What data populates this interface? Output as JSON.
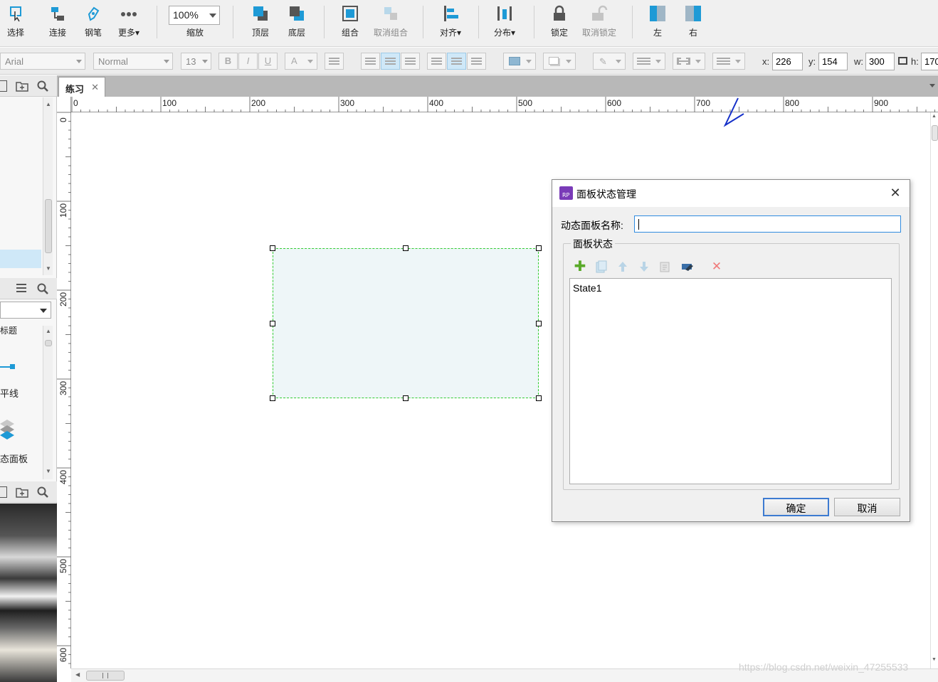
{
  "toolbar": {
    "select": "选择",
    "connect": "连接",
    "pen": "钢笔",
    "more": "更多▾",
    "zoom_value": "100%",
    "zoom": "缩放",
    "top_layer": "顶层",
    "bottom_layer": "底层",
    "group": "组合",
    "ungroup": "取消组合",
    "align": "对齐▾",
    "distribute": "分布▾",
    "lock": "锁定",
    "unlock": "取消锁定",
    "left": "左",
    "right": "右"
  },
  "format": {
    "font": "Arial",
    "style": "Normal",
    "size": "13",
    "bold": "B",
    "italic": "I",
    "underline": "U",
    "text_color": "A",
    "x_label": "x:",
    "x": "226",
    "y_label": "y:",
    "y": "154",
    "w_label": "w:",
    "w": "300",
    "h_label": "h:",
    "h": "170"
  },
  "left": {
    "widget_label_1": "标题",
    "widget_label_2": "平线",
    "widget_label_3": "态面板"
  },
  "tab": {
    "name": "练习",
    "close": "✕"
  },
  "ruler": {
    "h": [
      "0",
      "100",
      "200",
      "300",
      "400",
      "500",
      "600",
      "700",
      "800",
      "900"
    ],
    "v": [
      "0",
      "100",
      "200",
      "300",
      "400",
      "500",
      "600"
    ]
  },
  "dialog": {
    "title": "面板状态管理",
    "close": "✕",
    "name_label": "动态面板名称:",
    "name_value": "",
    "group_title": "面板状态",
    "states": [
      "State1"
    ],
    "ok": "确定",
    "cancel": "取消"
  },
  "watermark": "https://blog.csdn.net/weixin_47255533",
  "colors": {
    "accent": "#1e9ad6",
    "selection": "#33cc33",
    "add_green": "#5aaa2a",
    "delete_red": "#f07a7a"
  }
}
